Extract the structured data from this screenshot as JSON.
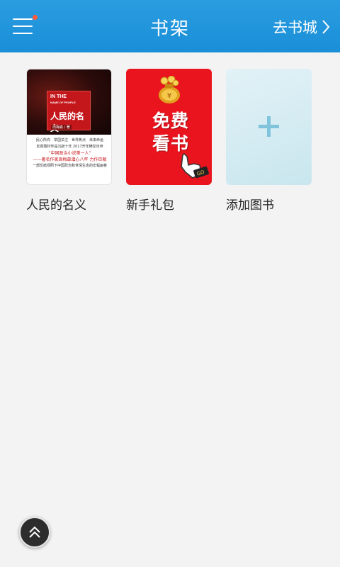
{
  "header": {
    "title": "书架",
    "to_store_label": "去书城",
    "menu_icon": "menu-icon",
    "chevron_icon": "chevron-right-icon",
    "notification_dot_color": "#ff5a3c",
    "bg_color": "#1f95dc"
  },
  "books": [
    {
      "title": "人民的名义",
      "cover": {
        "top_small": "IN THE",
        "top_small2": "NAME OF PEOPLE",
        "name": "人民的名义",
        "author": "周梅森 / 著",
        "lines": [
          "民心所向　举国关注　世界焦点　未来命运",
          "反腐题材作品沉寂十年 2017开年横空出世",
          "“中国政治小说第一人”",
          "——著名作家周梅森潜心八年 力作巨献",
          "一部反腐观照下中国政治和世情生态的宏幅画卷"
        ]
      }
    },
    {
      "title": "新手礼包",
      "cover": {
        "text_line1": "免费",
        "text_line2": "看书",
        "badge": "GO"
      }
    },
    {
      "title": "添加图书",
      "cover": {
        "icon": "plus-icon"
      }
    }
  ],
  "scroll_top": {
    "icon": "double-chevron-up-icon"
  }
}
